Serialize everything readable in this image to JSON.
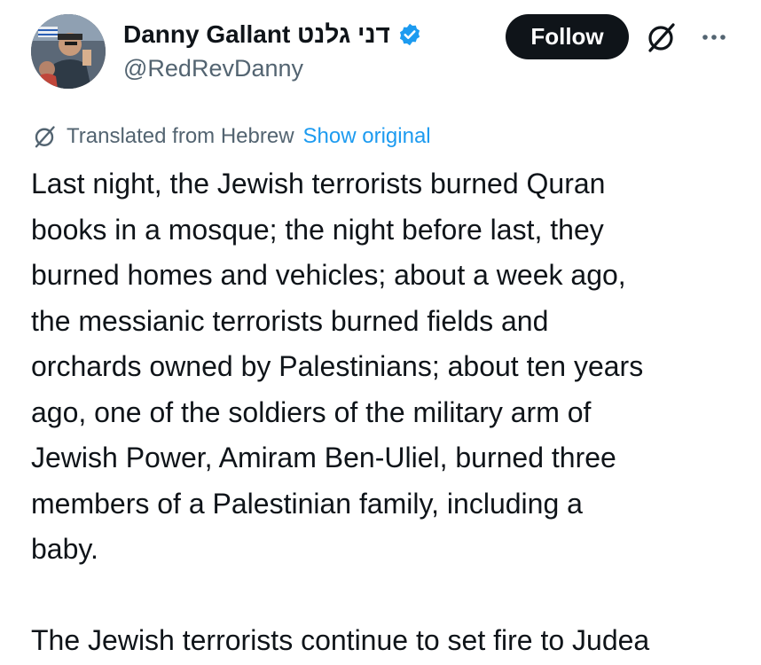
{
  "header": {
    "display_name": "Danny Gallant דני גלנט",
    "handle": "@RedRevDanny",
    "follow_label": "Follow",
    "more_icon": "more-dots-icon",
    "grok_icon": "grok-icon",
    "verified_icon": "verified-badge-icon",
    "verified_color": "#1d9bf0"
  },
  "translation": {
    "label": "Translated from Hebrew",
    "show_original": "Show original",
    "icon": "grok-icon"
  },
  "post": {
    "lines": [
      "Last night, the Jewish terrorists burned Quran",
      "books in a mosque; the night before last, they",
      "burned homes and vehicles; about a week ago,",
      "the messianic terrorists burned fields and",
      "orchards owned by Palestinians; about ten years",
      "ago, one of the soldiers of the military arm of",
      "Jewish Power, Amiram Ben-Uliel, burned three",
      "members of a Palestinian family, including a",
      "baby."
    ],
    "line_second_para": "The Jewish terrorists continue to set fire to Judea"
  },
  "colors": {
    "text": "#0f1419",
    "secondary": "#536471",
    "accent": "#1d9bf0",
    "button_bg": "#0f1419"
  }
}
